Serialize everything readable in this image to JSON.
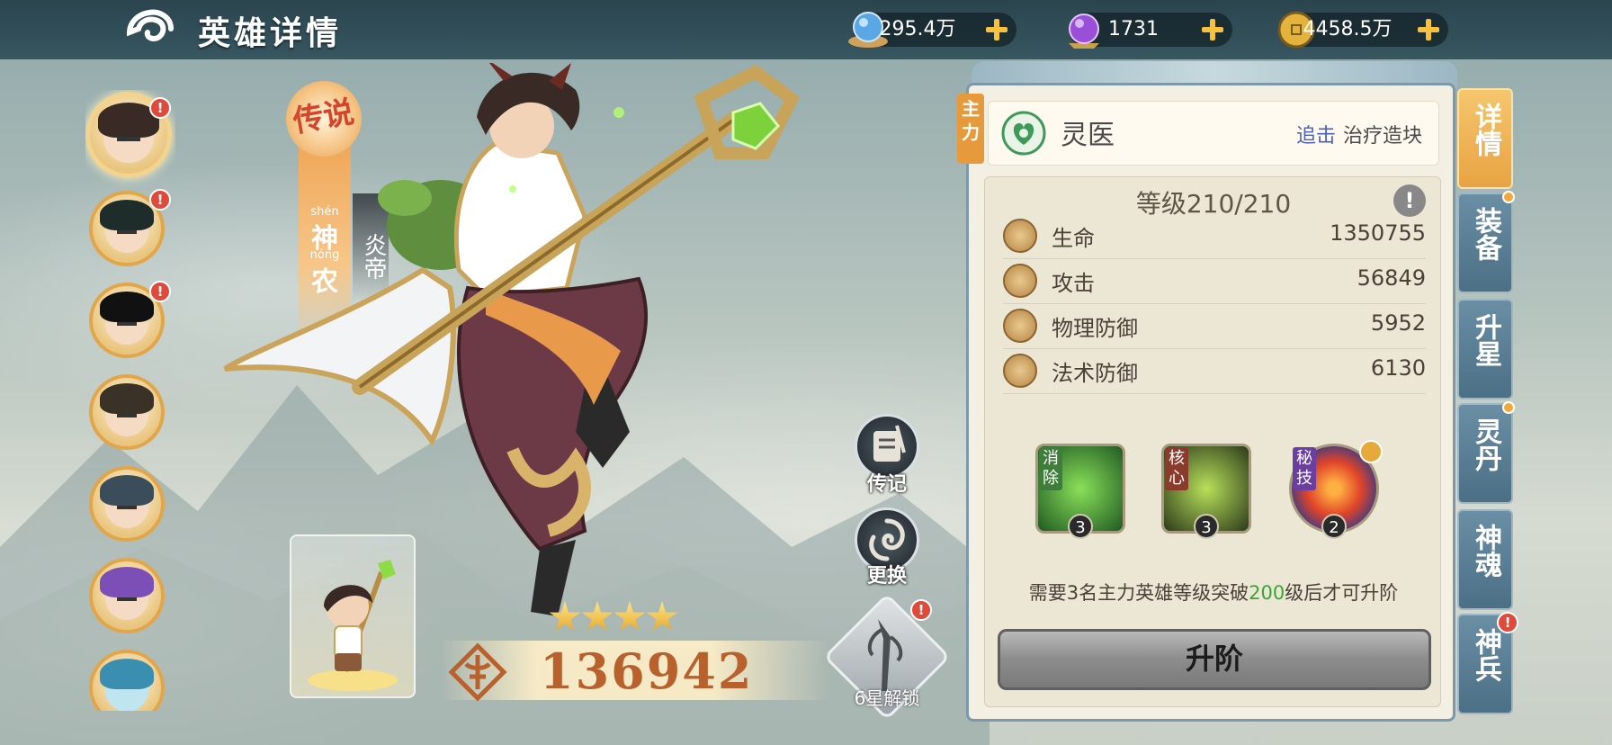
{
  "header": {
    "title": "英雄详情"
  },
  "resources": [
    {
      "name": "spirit-orb",
      "value": "295.4万",
      "color": "#59a8e4"
    },
    {
      "name": "purple-gem",
      "value": "1731",
      "color": "#9a4fd8"
    },
    {
      "name": "gold-coin",
      "value": "4458.5万",
      "color": "#e3b33c"
    }
  ],
  "hero": {
    "rarity": "传说",
    "pinyin_top": "shén",
    "name_1": "神",
    "pinyin_mid": "nóng",
    "name_2": "农",
    "title": "炎帝",
    "stars": 4,
    "power": "136942"
  },
  "actions": {
    "biography": "传记",
    "change": "更换",
    "unlock": "6星解锁"
  },
  "panel": {
    "main_tag": "主力",
    "class_name": "灵医",
    "tag_primary": "追击",
    "tag_secondary": "治疗造块",
    "level": "等级210/210",
    "stats": [
      {
        "label": "生命",
        "value": "1350755"
      },
      {
        "label": "攻击",
        "value": "56849"
      },
      {
        "label": "物理防御",
        "value": "5952"
      },
      {
        "label": "法术防御",
        "value": "6130"
      }
    ],
    "skills": [
      {
        "tag": "消除",
        "level": "3",
        "tag_color": "#3e7e3a"
      },
      {
        "tag": "核心",
        "level": "3",
        "tag_color": "#8a3b2b"
      },
      {
        "tag": "秘技",
        "level": "2",
        "tag_color": "#6a3fa0"
      }
    ],
    "note_before": "需要3名主力英雄等级突破",
    "note_level": "200",
    "note_after": "级后才可升阶",
    "advance_button": "升阶"
  },
  "tabs": [
    "详情",
    "装备",
    "升星",
    "灵丹",
    "神魂",
    "神兵"
  ],
  "hero_list_count": 7
}
